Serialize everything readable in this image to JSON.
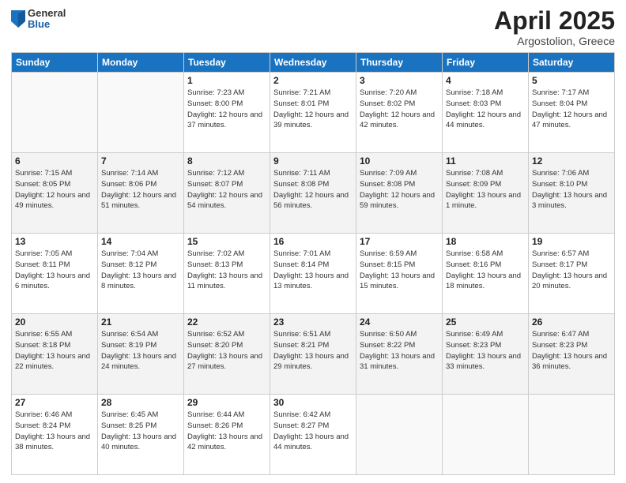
{
  "header": {
    "logo_general": "General",
    "logo_blue": "Blue",
    "title": "April 2025",
    "location": "Argostolion, Greece"
  },
  "days_of_week": [
    "Sunday",
    "Monday",
    "Tuesday",
    "Wednesday",
    "Thursday",
    "Friday",
    "Saturday"
  ],
  "weeks": [
    [
      {
        "day": "",
        "detail": ""
      },
      {
        "day": "",
        "detail": ""
      },
      {
        "day": "1",
        "detail": "Sunrise: 7:23 AM\nSunset: 8:00 PM\nDaylight: 12 hours and 37 minutes."
      },
      {
        "day": "2",
        "detail": "Sunrise: 7:21 AM\nSunset: 8:01 PM\nDaylight: 12 hours and 39 minutes."
      },
      {
        "day": "3",
        "detail": "Sunrise: 7:20 AM\nSunset: 8:02 PM\nDaylight: 12 hours and 42 minutes."
      },
      {
        "day": "4",
        "detail": "Sunrise: 7:18 AM\nSunset: 8:03 PM\nDaylight: 12 hours and 44 minutes."
      },
      {
        "day": "5",
        "detail": "Sunrise: 7:17 AM\nSunset: 8:04 PM\nDaylight: 12 hours and 47 minutes."
      }
    ],
    [
      {
        "day": "6",
        "detail": "Sunrise: 7:15 AM\nSunset: 8:05 PM\nDaylight: 12 hours and 49 minutes."
      },
      {
        "day": "7",
        "detail": "Sunrise: 7:14 AM\nSunset: 8:06 PM\nDaylight: 12 hours and 51 minutes."
      },
      {
        "day": "8",
        "detail": "Sunrise: 7:12 AM\nSunset: 8:07 PM\nDaylight: 12 hours and 54 minutes."
      },
      {
        "day": "9",
        "detail": "Sunrise: 7:11 AM\nSunset: 8:08 PM\nDaylight: 12 hours and 56 minutes."
      },
      {
        "day": "10",
        "detail": "Sunrise: 7:09 AM\nSunset: 8:08 PM\nDaylight: 12 hours and 59 minutes."
      },
      {
        "day": "11",
        "detail": "Sunrise: 7:08 AM\nSunset: 8:09 PM\nDaylight: 13 hours and 1 minute."
      },
      {
        "day": "12",
        "detail": "Sunrise: 7:06 AM\nSunset: 8:10 PM\nDaylight: 13 hours and 3 minutes."
      }
    ],
    [
      {
        "day": "13",
        "detail": "Sunrise: 7:05 AM\nSunset: 8:11 PM\nDaylight: 13 hours and 6 minutes."
      },
      {
        "day": "14",
        "detail": "Sunrise: 7:04 AM\nSunset: 8:12 PM\nDaylight: 13 hours and 8 minutes."
      },
      {
        "day": "15",
        "detail": "Sunrise: 7:02 AM\nSunset: 8:13 PM\nDaylight: 13 hours and 11 minutes."
      },
      {
        "day": "16",
        "detail": "Sunrise: 7:01 AM\nSunset: 8:14 PM\nDaylight: 13 hours and 13 minutes."
      },
      {
        "day": "17",
        "detail": "Sunrise: 6:59 AM\nSunset: 8:15 PM\nDaylight: 13 hours and 15 minutes."
      },
      {
        "day": "18",
        "detail": "Sunrise: 6:58 AM\nSunset: 8:16 PM\nDaylight: 13 hours and 18 minutes."
      },
      {
        "day": "19",
        "detail": "Sunrise: 6:57 AM\nSunset: 8:17 PM\nDaylight: 13 hours and 20 minutes."
      }
    ],
    [
      {
        "day": "20",
        "detail": "Sunrise: 6:55 AM\nSunset: 8:18 PM\nDaylight: 13 hours and 22 minutes."
      },
      {
        "day": "21",
        "detail": "Sunrise: 6:54 AM\nSunset: 8:19 PM\nDaylight: 13 hours and 24 minutes."
      },
      {
        "day": "22",
        "detail": "Sunrise: 6:52 AM\nSunset: 8:20 PM\nDaylight: 13 hours and 27 minutes."
      },
      {
        "day": "23",
        "detail": "Sunrise: 6:51 AM\nSunset: 8:21 PM\nDaylight: 13 hours and 29 minutes."
      },
      {
        "day": "24",
        "detail": "Sunrise: 6:50 AM\nSunset: 8:22 PM\nDaylight: 13 hours and 31 minutes."
      },
      {
        "day": "25",
        "detail": "Sunrise: 6:49 AM\nSunset: 8:23 PM\nDaylight: 13 hours and 33 minutes."
      },
      {
        "day": "26",
        "detail": "Sunrise: 6:47 AM\nSunset: 8:23 PM\nDaylight: 13 hours and 36 minutes."
      }
    ],
    [
      {
        "day": "27",
        "detail": "Sunrise: 6:46 AM\nSunset: 8:24 PM\nDaylight: 13 hours and 38 minutes."
      },
      {
        "day": "28",
        "detail": "Sunrise: 6:45 AM\nSunset: 8:25 PM\nDaylight: 13 hours and 40 minutes."
      },
      {
        "day": "29",
        "detail": "Sunrise: 6:44 AM\nSunset: 8:26 PM\nDaylight: 13 hours and 42 minutes."
      },
      {
        "day": "30",
        "detail": "Sunrise: 6:42 AM\nSunset: 8:27 PM\nDaylight: 13 hours and 44 minutes."
      },
      {
        "day": "",
        "detail": ""
      },
      {
        "day": "",
        "detail": ""
      },
      {
        "day": "",
        "detail": ""
      }
    ]
  ]
}
